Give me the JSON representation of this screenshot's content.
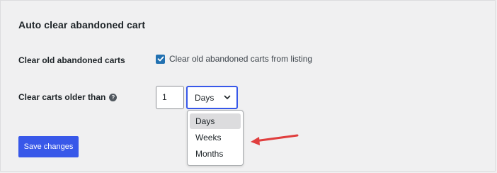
{
  "section": {
    "title": "Auto clear abandoned cart"
  },
  "fields": {
    "clear_old": {
      "label": "Clear old abandoned carts",
      "checkbox_checked": true,
      "checkbox_label": "Clear old abandoned carts from listing"
    },
    "clear_older_than": {
      "label": "Clear carts older than",
      "help_icon": "question-circle-icon",
      "number_value": "1",
      "unit_selected": "Days",
      "unit_options": [
        "Days",
        "Weeks",
        "Months"
      ]
    }
  },
  "actions": {
    "save_label": "Save changes"
  },
  "colors": {
    "accent": "#3858e9",
    "checkbox": "#2271b1",
    "arrow": "#e03e3e",
    "background": "#f0f0f1"
  }
}
